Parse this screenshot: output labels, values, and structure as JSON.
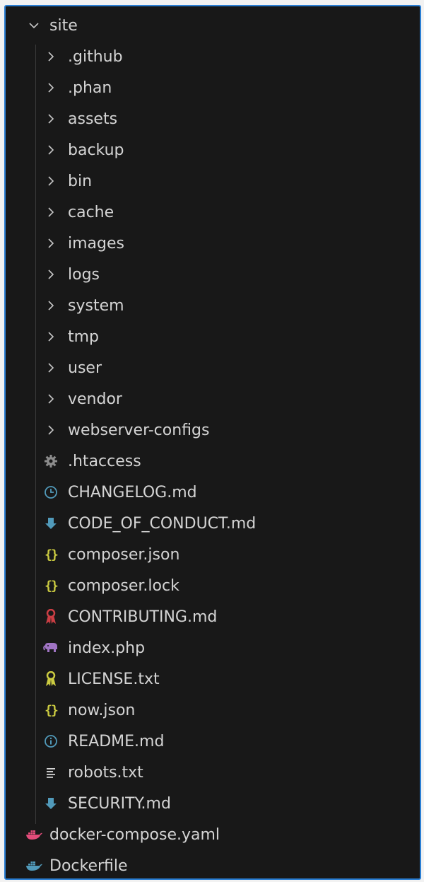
{
  "root_folder": {
    "label": "site",
    "icon": "chevron-down-icon",
    "expanded": true
  },
  "folders": [
    {
      "label": ".github"
    },
    {
      "label": ".phan"
    },
    {
      "label": "assets"
    },
    {
      "label": "backup"
    },
    {
      "label": "bin"
    },
    {
      "label": "cache"
    },
    {
      "label": "images"
    },
    {
      "label": "logs"
    },
    {
      "label": "system"
    },
    {
      "label": "tmp"
    },
    {
      "label": "user"
    },
    {
      "label": "vendor"
    },
    {
      "label": "webserver-configs"
    }
  ],
  "files": [
    {
      "label": ".htaccess",
      "icon": "gear-icon",
      "color": "#8c8c8c"
    },
    {
      "label": "CHANGELOG.md",
      "icon": "clock-icon",
      "color": "#519aba"
    },
    {
      "label": "CODE_OF_CONDUCT.md",
      "icon": "download-arrow-icon",
      "color": "#519aba"
    },
    {
      "label": "composer.json",
      "icon": "braces-icon",
      "color": "#cbcb41"
    },
    {
      "label": "composer.lock",
      "icon": "braces-icon",
      "color": "#cbcb41"
    },
    {
      "label": "CONTRIBUTING.md",
      "icon": "ribbon-icon",
      "color": "#cc3e44"
    },
    {
      "label": "index.php",
      "icon": "elephant-icon",
      "color": "#a074c4"
    },
    {
      "label": "LICENSE.txt",
      "icon": "ribbon-icon",
      "color": "#cbcb41"
    },
    {
      "label": "now.json",
      "icon": "braces-icon",
      "color": "#cbcb41"
    },
    {
      "label": "README.md",
      "icon": "info-icon",
      "color": "#519aba"
    },
    {
      "label": "robots.txt",
      "icon": "text-lines-icon",
      "color": "#d4d4d4"
    },
    {
      "label": "SECURITY.md",
      "icon": "download-arrow-icon",
      "color": "#519aba"
    }
  ],
  "outside_files": [
    {
      "label": "docker-compose.yaml",
      "icon": "docker-whale-icon",
      "color": "#e34c7a"
    },
    {
      "label": "Dockerfile",
      "icon": "docker-whale-icon",
      "color": "#519aba"
    }
  ]
}
